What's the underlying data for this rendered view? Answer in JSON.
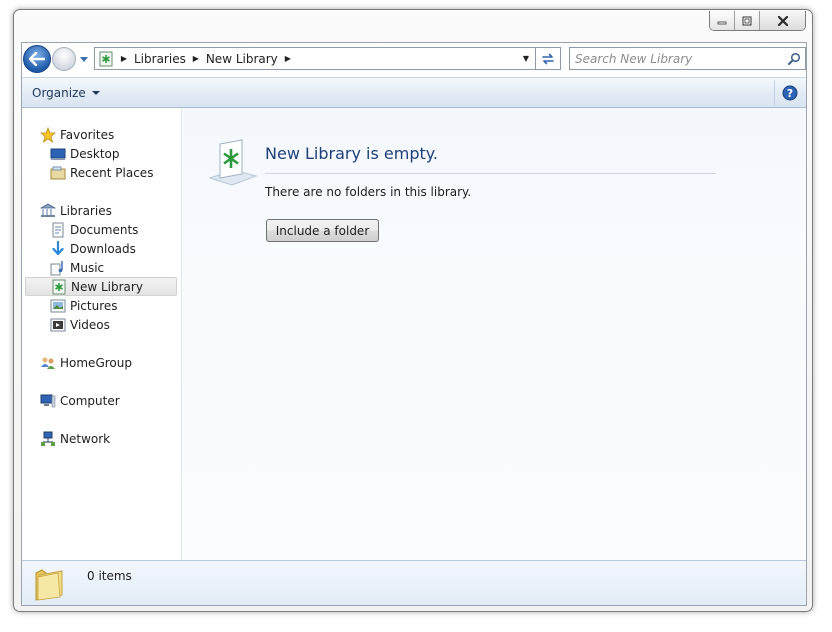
{
  "window": {
    "caption_buttons": [
      "minimize",
      "maximize",
      "close"
    ]
  },
  "navigation": {
    "breadcrumbs": [
      "Libraries",
      "New Library"
    ],
    "search_placeholder": "Search New Library"
  },
  "command_bar": {
    "organize_label": "Organize"
  },
  "nav_pane": {
    "favorites": {
      "label": "Favorites",
      "items": [
        {
          "label": "Desktop",
          "icon": "desktop-icon"
        },
        {
          "label": "Recent Places",
          "icon": "recent-places-icon"
        }
      ]
    },
    "libraries": {
      "label": "Libraries",
      "items": [
        {
          "label": "Documents",
          "icon": "documents-icon"
        },
        {
          "label": "Downloads",
          "icon": "downloads-icon"
        },
        {
          "label": "Music",
          "icon": "music-icon"
        },
        {
          "label": "New Library",
          "icon": "new-library-icon",
          "selected": true
        },
        {
          "label": "Pictures",
          "icon": "pictures-icon"
        },
        {
          "label": "Videos",
          "icon": "videos-icon"
        }
      ]
    },
    "homegroup": {
      "label": "HomeGroup"
    },
    "computer": {
      "label": "Computer"
    },
    "network": {
      "label": "Network"
    }
  },
  "content": {
    "title": "New Library is empty.",
    "message": "There are no folders in this library.",
    "include_button_label": "Include a folder"
  },
  "details": {
    "item_count": "0 items"
  },
  "colors": {
    "accent_title": "#1e3f7a",
    "command_bar": "#dfe9f5",
    "library_green": "#2a9a3a"
  }
}
